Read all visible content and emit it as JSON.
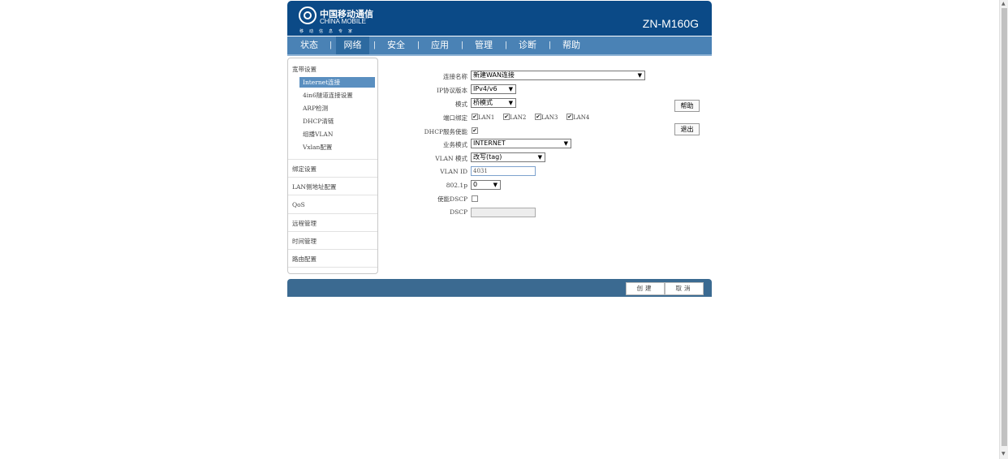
{
  "header": {
    "logo_cn": "中国移动通信",
    "logo_en": "CHINA MOBILE",
    "logo_slogan": "移动信息专家",
    "model": "ZN-M160G"
  },
  "nav": {
    "items": [
      {
        "label": "状态"
      },
      {
        "label": "网络"
      },
      {
        "label": "安全"
      },
      {
        "label": "应用"
      },
      {
        "label": "管理"
      },
      {
        "label": "诊断"
      },
      {
        "label": "帮助"
      }
    ],
    "separator": "|"
  },
  "sidebar": {
    "groups": [
      {
        "label": "宽带设置"
      },
      {
        "label": "绑定设置"
      },
      {
        "label": "LAN侧地址配置"
      },
      {
        "label": "QoS"
      },
      {
        "label": "远程管理"
      },
      {
        "label": "时间管理"
      },
      {
        "label": "路由配置"
      }
    ],
    "sub_items": [
      {
        "label": "Internet连接"
      },
      {
        "label": "4in6隧道连接设置"
      },
      {
        "label": "ARP检测"
      },
      {
        "label": "DHCP清链"
      },
      {
        "label": "组播VLAN"
      },
      {
        "label": "Vxlan配置"
      }
    ]
  },
  "form": {
    "conn_name_label": "连接名称",
    "conn_name_value": "新建WAN连接",
    "ip_version_label": "IP协议版本",
    "ip_version_value": "IPv4/v6",
    "mode_label": "模式",
    "mode_value": "桥模式",
    "port_bind_label": "端口绑定",
    "ports": [
      "LAN1",
      "LAN2",
      "LAN3",
      "LAN4"
    ],
    "dhcp_label": "DHCP服务使能",
    "service_mode_label": "业务模式",
    "service_mode_value": "INTERNET",
    "vlan_mode_label": "VLAN 模式",
    "vlan_mode_value": "改写(tag)",
    "vlan_id_label": "VLAN ID",
    "vlan_id_value": "4031",
    "dot1p_label": "802.1p",
    "dot1p_value": "0",
    "dscp_enable_label": "使能DSCP",
    "dscp_label": "DSCP",
    "dscp_value": "",
    "arrow": "▼",
    "check": "✔"
  },
  "side_buttons": {
    "help": "帮助",
    "logout": "退出"
  },
  "footer": {
    "create": "创建",
    "cancel": "取消"
  },
  "colors": {
    "header_bg": "#0b4a87",
    "nav_bg": "#4a82b5",
    "nav_active": "#2d6aa0",
    "sidebar_active": "#5a8fc0",
    "footer_bg": "#3b6a91"
  }
}
